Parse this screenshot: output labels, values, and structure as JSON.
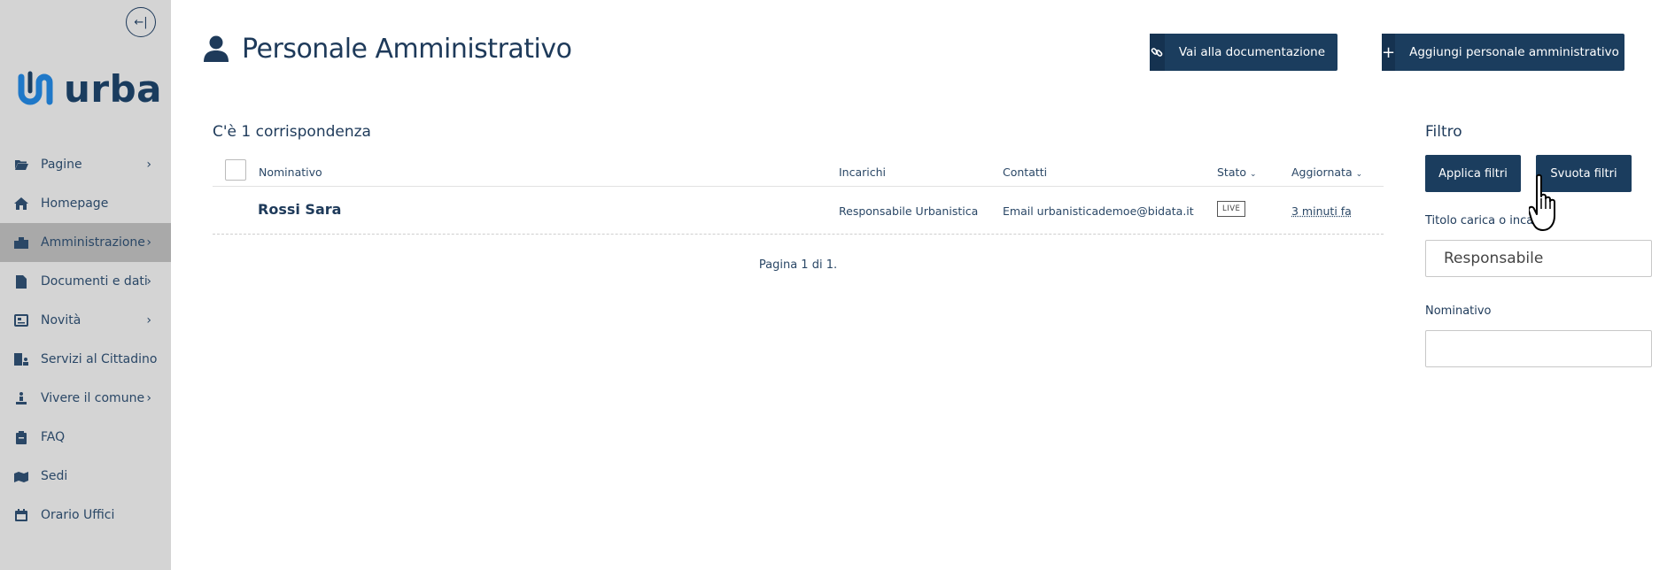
{
  "sidebar": {
    "collapse_glyph": "←|",
    "logo_text": "urba",
    "items": [
      {
        "label": "Pagine",
        "icon": "folder-open-icon",
        "chevron": true,
        "active": false
      },
      {
        "label": "Homepage",
        "icon": "home-icon",
        "chevron": false,
        "active": false
      },
      {
        "label": "Amministrazione",
        "icon": "city-icon",
        "chevron": true,
        "active": true
      },
      {
        "label": "Documenti e dati",
        "icon": "file-icon",
        "chevron": true,
        "active": false
      },
      {
        "label": "Novità",
        "icon": "newspaper-icon",
        "chevron": true,
        "active": false
      },
      {
        "label": "Servizi al Cittadino",
        "icon": "building-user-icon",
        "chevron": false,
        "active": false
      },
      {
        "label": "Vivere il comune",
        "icon": "person-monument-icon",
        "chevron": true,
        "active": false
      },
      {
        "label": "FAQ",
        "icon": "clipboard-icon",
        "chevron": false,
        "active": false
      },
      {
        "label": "Sedi",
        "icon": "map-location-icon",
        "chevron": false,
        "active": false
      },
      {
        "label": "Orario Uffici",
        "icon": "calendar-icon",
        "chevron": false,
        "active": false
      }
    ]
  },
  "header": {
    "title": "Personale Amministrativo",
    "doc_button": "Vai alla documentazione",
    "add_button": "Aggiungi personale amministrativo"
  },
  "results": {
    "count_text": "C'è 1 corrispondenza",
    "columns": {
      "name": "Nominativo",
      "roles": "Incarichi",
      "contacts": "Contatti",
      "status": "Stato",
      "updated": "Aggiornata"
    },
    "rows": [
      {
        "name": "Rossi Sara",
        "roles": "Responsabile Urbanistica",
        "contacts": "Email urbanisticademoe@bidata.it",
        "status": "LIVE",
        "updated": "3 minuti fa"
      }
    ],
    "pagination": "Pagina 1 di 1."
  },
  "filter": {
    "title": "Filtro",
    "apply_button": "Applica filtri",
    "clear_button": "Svuota filtri",
    "role_label": "Titolo carica o incarico",
    "role_value": "Responsabile",
    "name_label": "Nominativo",
    "name_value": ""
  },
  "colors": {
    "sidebar_bg": "#d4d4d4",
    "sidebar_active": "#a9a9a9",
    "primary_dark": "#1b3d5e",
    "text": "#1e3a5a",
    "logo_accent": "#1f78c8"
  }
}
